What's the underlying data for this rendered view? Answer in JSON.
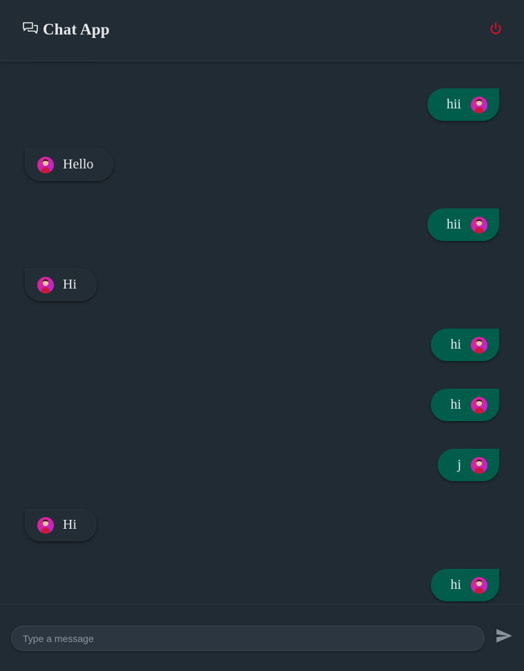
{
  "header": {
    "title": "Chat App",
    "icon": "chat-bubbles-icon",
    "logout_icon": "power-icon",
    "logout_color": "#d0102b"
  },
  "messages": [
    {
      "direction": "out",
      "text": "hii"
    },
    {
      "direction": "in",
      "text": "Hello"
    },
    {
      "direction": "out",
      "text": "hii"
    },
    {
      "direction": "in",
      "text": "Hi"
    },
    {
      "direction": "out",
      "text": "hi"
    },
    {
      "direction": "out",
      "text": "hi"
    },
    {
      "direction": "out",
      "text": "j"
    },
    {
      "direction": "in",
      "text": "Hi"
    },
    {
      "direction": "out",
      "text": "hi"
    }
  ],
  "composer": {
    "placeholder": "Type a message",
    "value": "",
    "send_icon": "send-icon"
  },
  "colors": {
    "background": "#202b33",
    "outgoing_bubble": "#005c4b",
    "incoming_bubble": "#222d36",
    "avatar_gradient_start": "#e8208a",
    "avatar_gradient_end": "#b428d8"
  }
}
